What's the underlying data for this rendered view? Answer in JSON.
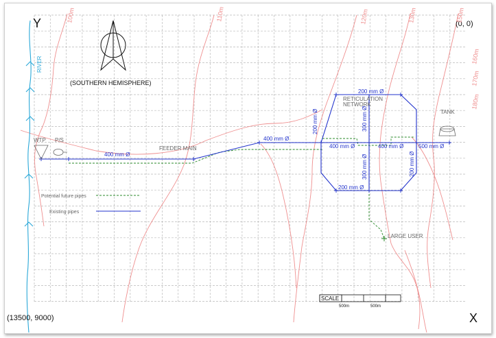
{
  "axes": {
    "y_label": "Y",
    "x_label": "X",
    "origin": "(0, 0)",
    "extent": "(13500, 9000)"
  },
  "hemisphere": "(SOUTHERN HEMISPHERE)",
  "labels": {
    "river": "RIVER",
    "wtp": "WTP",
    "ps": "P/S",
    "feeder_main": "FEEDER MAIN",
    "reticulation_1": "RETICULATION",
    "reticulation_2": "NETWORK",
    "tank": "TANK",
    "large_user": "LARGE USER"
  },
  "legend": {
    "future": "Potential future pipes",
    "existing": "Existing pipes"
  },
  "pipes": {
    "p1": "400 mm Ø",
    "p2": "400 mm Ø",
    "p3": "200 mm Ø",
    "p4": "300 mm Ø",
    "p5": "200 mm Ø",
    "p6": "400 mm Ø",
    "p7": "400 mm Ø",
    "p8": "500 mm Ø",
    "p9": "300 mm Ø",
    "p10": "200 mm Ø",
    "p11": "200 mm Ø"
  },
  "contours": {
    "c1": "100m",
    "c2": "110m",
    "c3": "120m",
    "c4": "130m",
    "c5": "150m",
    "c6": "160m",
    "c7": "170m",
    "c8": "180m"
  },
  "scale": {
    "title": "SCALE",
    "d1": "500m",
    "d2": "500m"
  },
  "colors": {
    "existing_pipe": "#2233cc",
    "future_pipe": "#2a8a2a",
    "contour": "#ef8f8f",
    "river": "#2aa8d8"
  }
}
